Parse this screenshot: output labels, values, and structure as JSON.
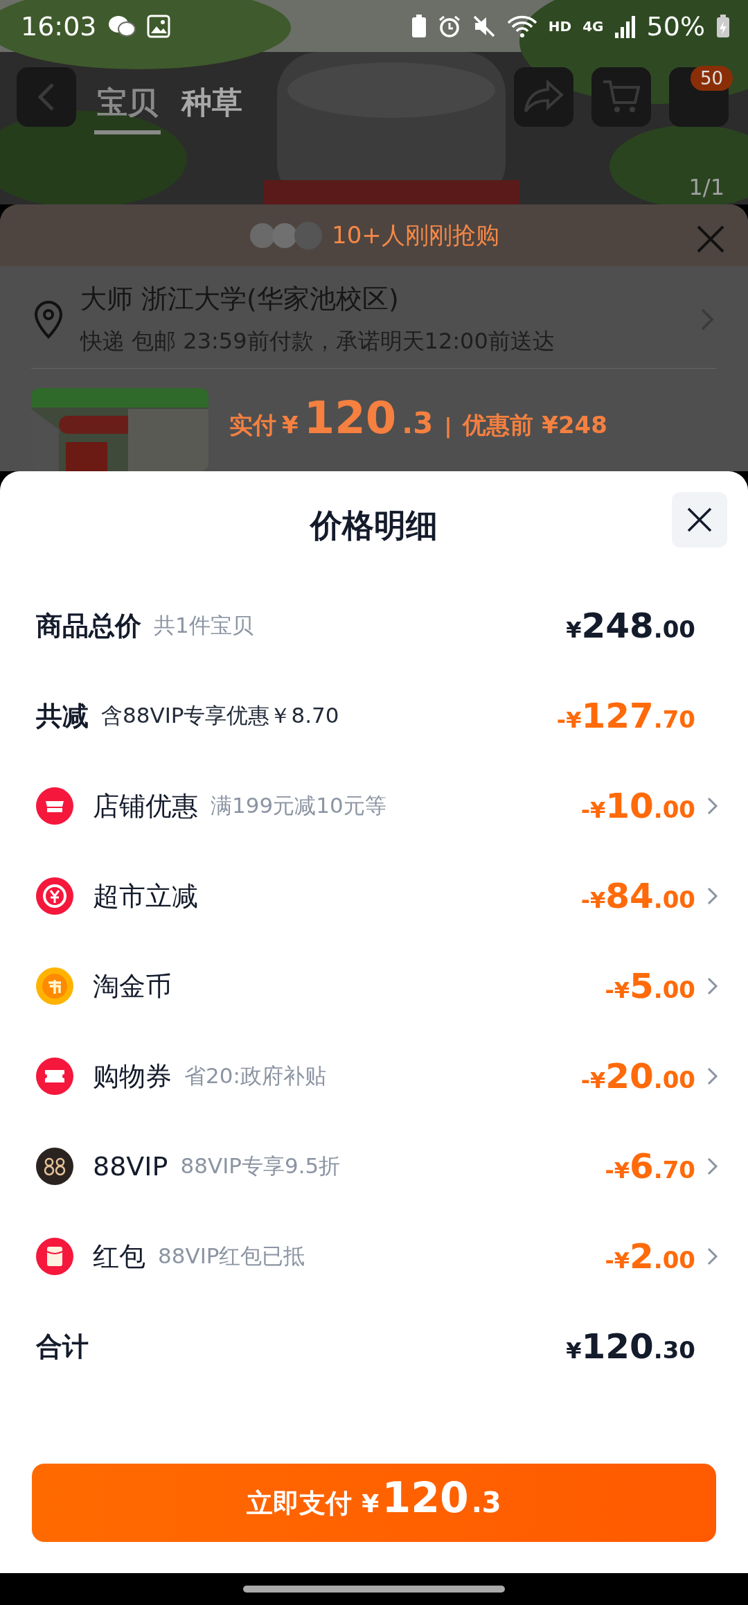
{
  "status_bar": {
    "time": "16:03",
    "network": "HD",
    "network_type": "4G",
    "battery": "50%"
  },
  "header": {
    "tabs": [
      {
        "label": "宝贝",
        "selected": true
      },
      {
        "label": "种草",
        "selected": false
      }
    ],
    "cart_badge": "50",
    "image_counter": "1/1"
  },
  "order_sheet": {
    "banner": "10+人刚刚抢购",
    "address": {
      "name": "大师 浙江大学(华家池校区)",
      "delivery": "快递 包邮 23:59前付款，承诺明天12:00前送达"
    },
    "product": {
      "paid_label": "实付",
      "paid_currency": "¥",
      "paid_integer": "120",
      "paid_fraction": ".3",
      "separator": "|",
      "original": "优惠前 ¥248"
    }
  },
  "price_detail": {
    "title": "价格明细",
    "rows": [
      {
        "kind": "subtotal",
        "label": "商品总价",
        "note": "共1件宝贝",
        "amount": {
          "prefix": "¥",
          "integer": "248",
          "fraction": ".00"
        }
      },
      {
        "kind": "summary",
        "label": "共减",
        "note": "含88VIP专享优惠￥8.70",
        "amount": {
          "prefix": "-¥",
          "integer": "127",
          "fraction": ".70"
        }
      },
      {
        "kind": "discount",
        "label": "店铺优惠",
        "note": "满199元减10元等",
        "amount": {
          "prefix": "-¥",
          "integer": "10",
          "fraction": ".00"
        }
      },
      {
        "kind": "discount",
        "label": "超市立减",
        "amount": {
          "prefix": "-¥",
          "integer": "84",
          "fraction": ".00"
        }
      },
      {
        "kind": "discount",
        "label": "淘金币",
        "amount": {
          "prefix": "-¥",
          "integer": "5",
          "fraction": ".00"
        }
      },
      {
        "kind": "discount",
        "label": "购物券",
        "note": "省20:政府补贴",
        "amount": {
          "prefix": "-¥",
          "integer": "20",
          "fraction": ".00"
        }
      },
      {
        "kind": "discount",
        "label": "88VIP",
        "note": "88VIP专享9.5折",
        "amount": {
          "prefix": "-¥",
          "integer": "6",
          "fraction": ".70"
        }
      },
      {
        "kind": "discount",
        "label": "红包",
        "note": "88VIP红包已抵",
        "amount": {
          "prefix": "-¥",
          "integer": "2",
          "fraction": ".00"
        }
      },
      {
        "kind": "subtotal",
        "label": "合计",
        "amount": {
          "prefix": "¥",
          "integer": "120",
          "fraction": ".30"
        }
      }
    ],
    "pay_button": {
      "label": "立即支付",
      "currency": "¥",
      "integer": "120",
      "fraction": ".3"
    }
  }
}
